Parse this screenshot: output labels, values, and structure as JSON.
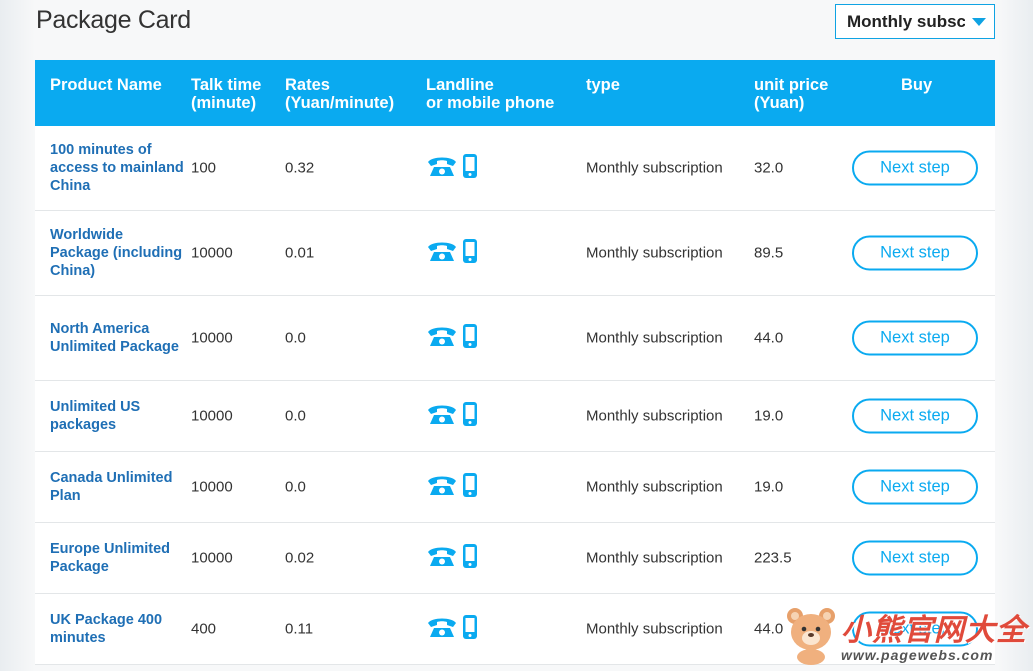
{
  "page": {
    "title": "Package Card",
    "filter": {
      "selected": "Monthly subscription",
      "icon": "caret-down-icon"
    }
  },
  "table": {
    "headers": {
      "product_name": "Product Name",
      "talk_time_1": "Talk time",
      "talk_time_2": "(minute)",
      "rates_1": "Rates",
      "rates_2": "(Yuan/minute)",
      "phone_1": "Landline",
      "phone_2": "or mobile phone",
      "type": "type",
      "price_1": "unit price",
      "price_2": "(Yuan)",
      "buy": "Buy"
    },
    "rows": [
      {
        "name": "100 minutes of access to mainland China",
        "talk_time": "100",
        "rate": "0.32",
        "type": "Monthly subscription",
        "price": "32.0",
        "button": "Next step"
      },
      {
        "name": "Worldwide Package (including China)",
        "talk_time": "10000",
        "rate": "0.01",
        "type": "Monthly subscription",
        "price": "89.5",
        "button": "Next step"
      },
      {
        "name": "North America Unlimited Package",
        "talk_time": "10000",
        "rate": "0.0",
        "type": "Monthly subscription",
        "price": "44.0",
        "button": "Next step"
      },
      {
        "name": "Unlimited US packages",
        "talk_time": "10000",
        "rate": "0.0",
        "type": "Monthly subscription",
        "price": "19.0",
        "button": "Next step"
      },
      {
        "name": "Canada Unlimited Plan",
        "talk_time": "10000",
        "rate": "0.0",
        "type": "Monthly subscription",
        "price": "19.0",
        "button": "Next step"
      },
      {
        "name": "Europe Unlimited Package",
        "talk_time": "10000",
        "rate": "0.02",
        "type": "Monthly subscription",
        "price": "223.5",
        "button": "Next step"
      },
      {
        "name": "UK Package 400 minutes",
        "talk_time": "400",
        "rate": "0.11",
        "type": "Monthly subscription",
        "price": "44.0",
        "button": "Next step"
      }
    ]
  },
  "icons": {
    "landline": "landline-phone-icon",
    "mobile": "mobile-phone-icon"
  },
  "colors": {
    "accent": "#0aaaf0",
    "product_link": "#1f6fb5",
    "watermark": "#e04a3b"
  },
  "watermark": {
    "text": "小熊官网大全",
    "url": "www.pagewebs.com"
  }
}
